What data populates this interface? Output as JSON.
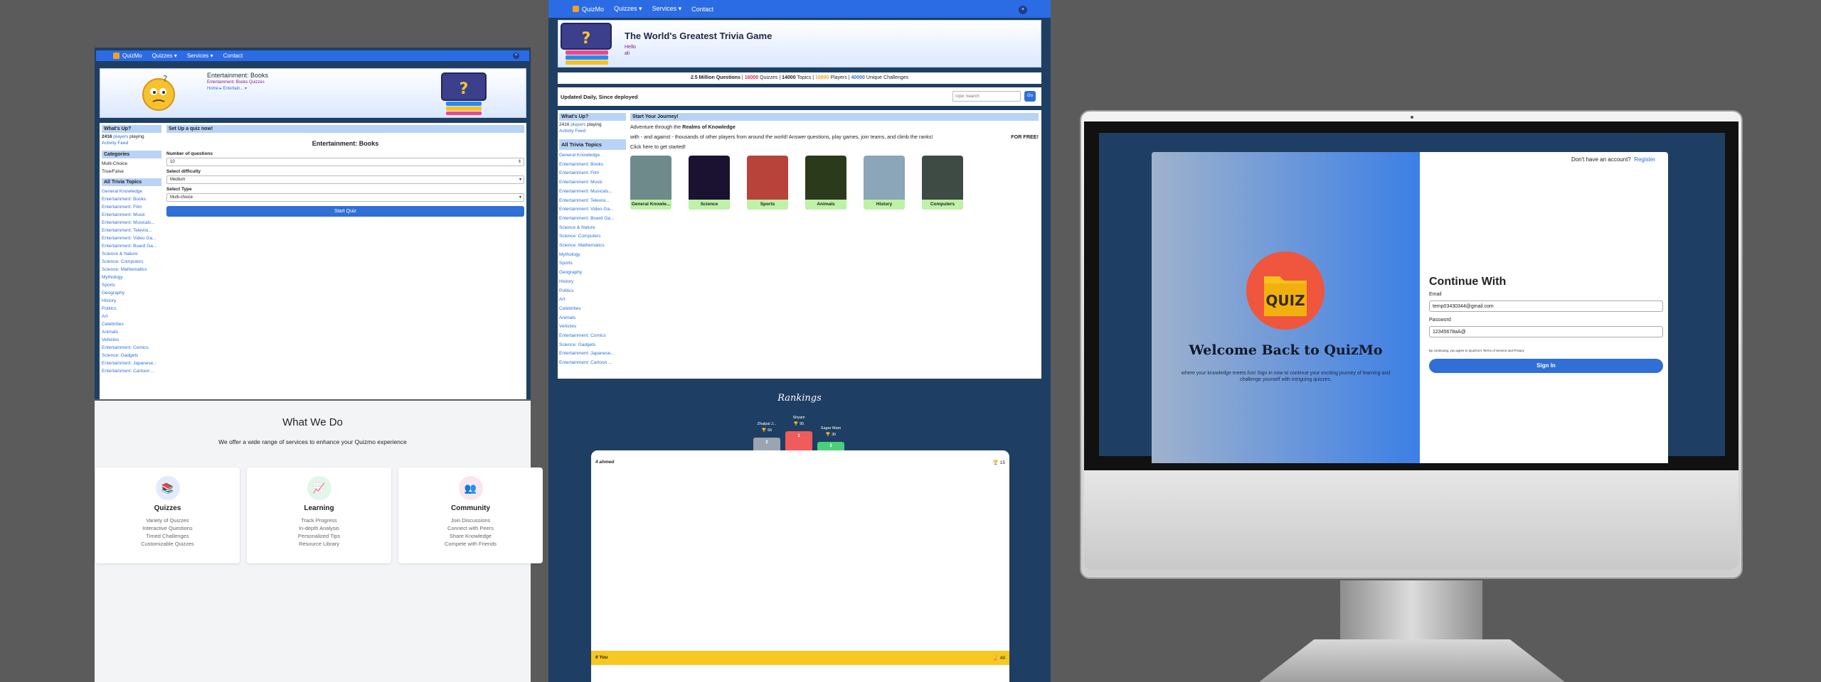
{
  "brand": "QuizMo",
  "nav": {
    "quizzes": "Quizzes",
    "services": "Services",
    "contact": "Contact",
    "close": "×"
  },
  "p1": {
    "hero_title": "Entertainment: Books",
    "hero_sub": "Entertainment: Books Quizzes",
    "crumb_home": "Home",
    "crumb_cur": "Entertain...",
    "whats_up": "What's Up?",
    "players_count": "2416",
    "players_link": "players",
    "players_suffix": "playing",
    "activity": "Activity Feed",
    "categories": "Categories",
    "cat_items": [
      "Multi-Choice",
      "True/False"
    ],
    "all_topics": "All Trivia Topics",
    "topics": [
      "General Knowledge",
      "Entertainment: Books",
      "Entertainment: Film",
      "Entertainment: Music",
      "Entertainment: Musicals...",
      "Entertainment: Televisi...",
      "Entertainment: Video Ga...",
      "Entertainment: Board Ga...",
      "Science & Nature",
      "Science: Computers",
      "Science: Mathematics",
      "Mythology",
      "Sports",
      "Geography",
      "History",
      "Politics",
      "Art",
      "Celebrities",
      "Animals",
      "Vehicles",
      "Entertainment: Comics",
      "Science: Gadgets",
      "Entertainment: Japanese...",
      "Entertainment: Cartoon ..."
    ],
    "setup": "Set Up a quiz now!",
    "form_title": "Entertainment: Books",
    "num_label": "Number of questions",
    "num_value": "10",
    "diff_label": "Select difficulty",
    "diff_value": "Medium",
    "type_label": "Select Type",
    "type_value": "Multi-choice",
    "start": "Start Quiz"
  },
  "wwd": {
    "title": "What We Do",
    "sub": "We offer a wide range of services to enhance your Quizmo experience",
    "cards": [
      {
        "title": "Quizzes",
        "icon": "📚",
        "color": "#e4ebff",
        "items": [
          "Variety of Quizzes",
          "Interactive Questions",
          "Timed Challenges",
          "Customizable Quizzes"
        ]
      },
      {
        "title": "Learning",
        "icon": "📈",
        "color": "#e3f6e9",
        "items": [
          "Track Progress",
          "In-depth Analysis",
          "Personalized Tips",
          "Resource Library"
        ]
      },
      {
        "title": "Community",
        "icon": "👥",
        "color": "#fbe6f0",
        "items": [
          "Join Discussions",
          "Connect with Peers",
          "Share Knowledge",
          "Compete with Friends"
        ]
      }
    ]
  },
  "p2": {
    "title": "The World's Greatest Trivia Game",
    "hello": "Hello",
    "hello_name": "ali",
    "stats": {
      "millions": "2.5 Million",
      "questions": "Questions",
      "quizzes_n": "16000",
      "quizzes": "Quizzes",
      "topics_n": "14000",
      "topics": "Topics",
      "players_n": "10000",
      "players": "Players",
      "chal_n": "40000",
      "chal": "Unique Challenges"
    },
    "updated": "Updated Daily, Since deployed",
    "search_ph": "Topic Search",
    "go": "Go",
    "whats_up": "What's Up?",
    "players_count": "2416",
    "players_link": "players",
    "players_suffix": "playing",
    "activity": "Activity Feed",
    "all_topics": "All Trivia Topics",
    "topics": [
      "General Knowledge",
      "Entertainment: Books",
      "Entertainment: Film",
      "Entertainment: Music",
      "Entertainment: Musicals...",
      "Entertainment: Televisi...",
      "Entertainment: Video Ga...",
      "Entertainment: Board Ga...",
      "Science & Nature",
      "Science: Computers",
      "Science: Mathematics",
      "Mythology",
      "Sports",
      "Geography",
      "History",
      "Politics",
      "Art",
      "Celebrities",
      "Animals",
      "Vehicles",
      "Entertainment: Comics",
      "Science: Gadgets",
      "Entertainment: Japanese...",
      "Entertainment: Cartoon ..."
    ],
    "journey": "Start Your Journey!",
    "intro_a": "Adventure through the",
    "intro_b": "Realms of Knowledge",
    "intro_c": "with - and against - thousands of other players from around the world! Answer questions, play games, join teams, and climb the ranks!",
    "free": "FOR FREE!",
    "click": "Click here to get started!",
    "tiles": [
      {
        "label": "General Knowle...",
        "bg": "#6f8a8a"
      },
      {
        "label": "Science",
        "bg": "#1a1230"
      },
      {
        "label": "Sports",
        "bg": "#b8433a"
      },
      {
        "label": "Animals",
        "bg": "#2c3a1c"
      },
      {
        "label": "History",
        "bg": "#8aa6b8"
      },
      {
        "label": "Computers",
        "bg": "#3e4a44"
      }
    ],
    "rankings": "Rankings",
    "podium": [
      {
        "name": "Zhalpal J...",
        "score": "66",
        "rank": "2",
        "color": "#9aa5b1"
      },
      {
        "name": "Shyam",
        "score": "95",
        "rank": "1",
        "color": "#f05b5b"
      },
      {
        "name": "Sagar Mam",
        "score": "30",
        "rank": "3",
        "color": "#4ccf7a"
      }
    ],
    "list_first_name": "ahmed",
    "list_first_score": "15",
    "you": "You",
    "you_score": "49"
  },
  "login": {
    "no_account": "Don't have an account?",
    "register": "Register",
    "logo_text": "QUIZ",
    "welcome": "Welcome Back to QuizMo",
    "welcome_sub": "where your knowledge meets fun! Sign in now to continue your exciting journey of learning and challenge yourself with intriguing quizzes.",
    "continue": "Continue With",
    "email_label": "Email",
    "email_value": "temp03430344@gmail.com",
    "pw_label": "Password",
    "pw_value": "12345678aA@",
    "terms": "By continuing, you agree to Quizmo's Terms of Service and Privacy",
    "signin": "Sign In"
  }
}
